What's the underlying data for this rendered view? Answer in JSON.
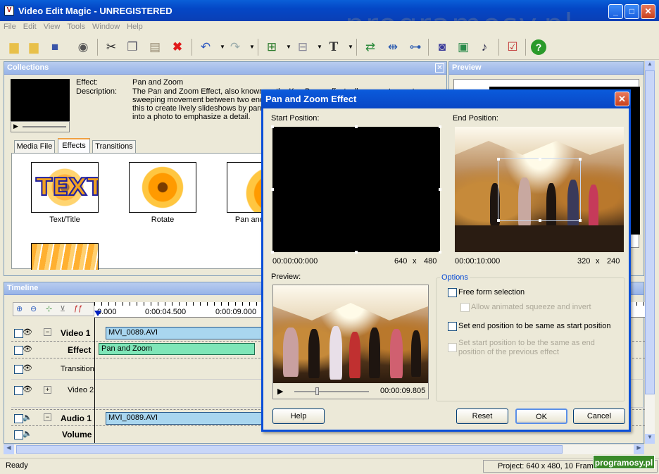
{
  "window": {
    "title": "Video Edit Magic - UNREGISTERED",
    "icon": "app-icon"
  },
  "menu": [
    "File",
    "Edit",
    "View",
    "Tools",
    "Window",
    "Help"
  ],
  "watermark": "programosy.pl",
  "collections": {
    "title": "Collections",
    "effect_label": "Effect:",
    "effect_value": "Pan and Zoom",
    "description_label": "Description:",
    "description_lines": [
      "The Pan and Zoom Effect, also known as the Ken Burns effect, allows you to create",
      "sweeping movement between two end points, zooming in or out. Use",
      "this to create lively slideshows by panning across photographs, or to zoom",
      "into a photo to emphasize a detail."
    ],
    "tabs": [
      "Media File",
      "Effects",
      "Transitions"
    ],
    "active_tab": "Effects",
    "effects": [
      {
        "label": "Text/Title"
      },
      {
        "label": "Rotate"
      },
      {
        "label": "Pan and Zoom"
      },
      {
        "label": ""
      }
    ]
  },
  "preview_panel": {
    "title": "Preview"
  },
  "timeline": {
    "title": "Timeline",
    "ruler": [
      "0.000",
      "0:00:04.500",
      "0:00:09.000"
    ],
    "tracks": [
      {
        "name": "Video 1",
        "bold": true,
        "clip": "MVI_0089.AVI"
      },
      {
        "name": "Effect",
        "bold": true,
        "clip": "Pan and Zoom"
      },
      {
        "name": "Transition",
        "bold": false,
        "clip": ""
      },
      {
        "name": "Video 2",
        "bold": false,
        "clip": ""
      },
      {
        "name": "Audio 1",
        "bold": true,
        "clip": "MVI_0089.AVI"
      },
      {
        "name": "Volume",
        "bold": true,
        "clip": ""
      }
    ]
  },
  "dialog": {
    "title": "Pan and Zoom Effect",
    "start_label": "Start Position:",
    "end_label": "End Position:",
    "start_time": "00:00:00:000",
    "start_w": "640",
    "start_h": "480",
    "end_time": "00:00:10:000",
    "end_w": "320",
    "end_h": "240",
    "x": "x",
    "preview_label": "Preview:",
    "preview_time": "00:00:09.805",
    "options_label": "Options",
    "opt_free_form": "Free form selection",
    "opt_allow_squeeze": "Allow animated squeeze and invert",
    "opt_end_same": "Set end position to be same as start position",
    "opt_start_same_1": "Set start position to be the same as end",
    "opt_start_same_2": "position of the previous effect",
    "btn_help": "Help",
    "btn_reset": "Reset",
    "btn_ok": "OK",
    "btn_cancel": "Cancel",
    "preview_progress": 0.3
  },
  "status": {
    "left": "Ready",
    "right": "Project: 640 x 480, 10 Frames/Second"
  },
  "colors": {
    "accent": "#0b4fd8",
    "clip_video": "#a9d6ef",
    "clip_effect": "#7fe6b8"
  }
}
